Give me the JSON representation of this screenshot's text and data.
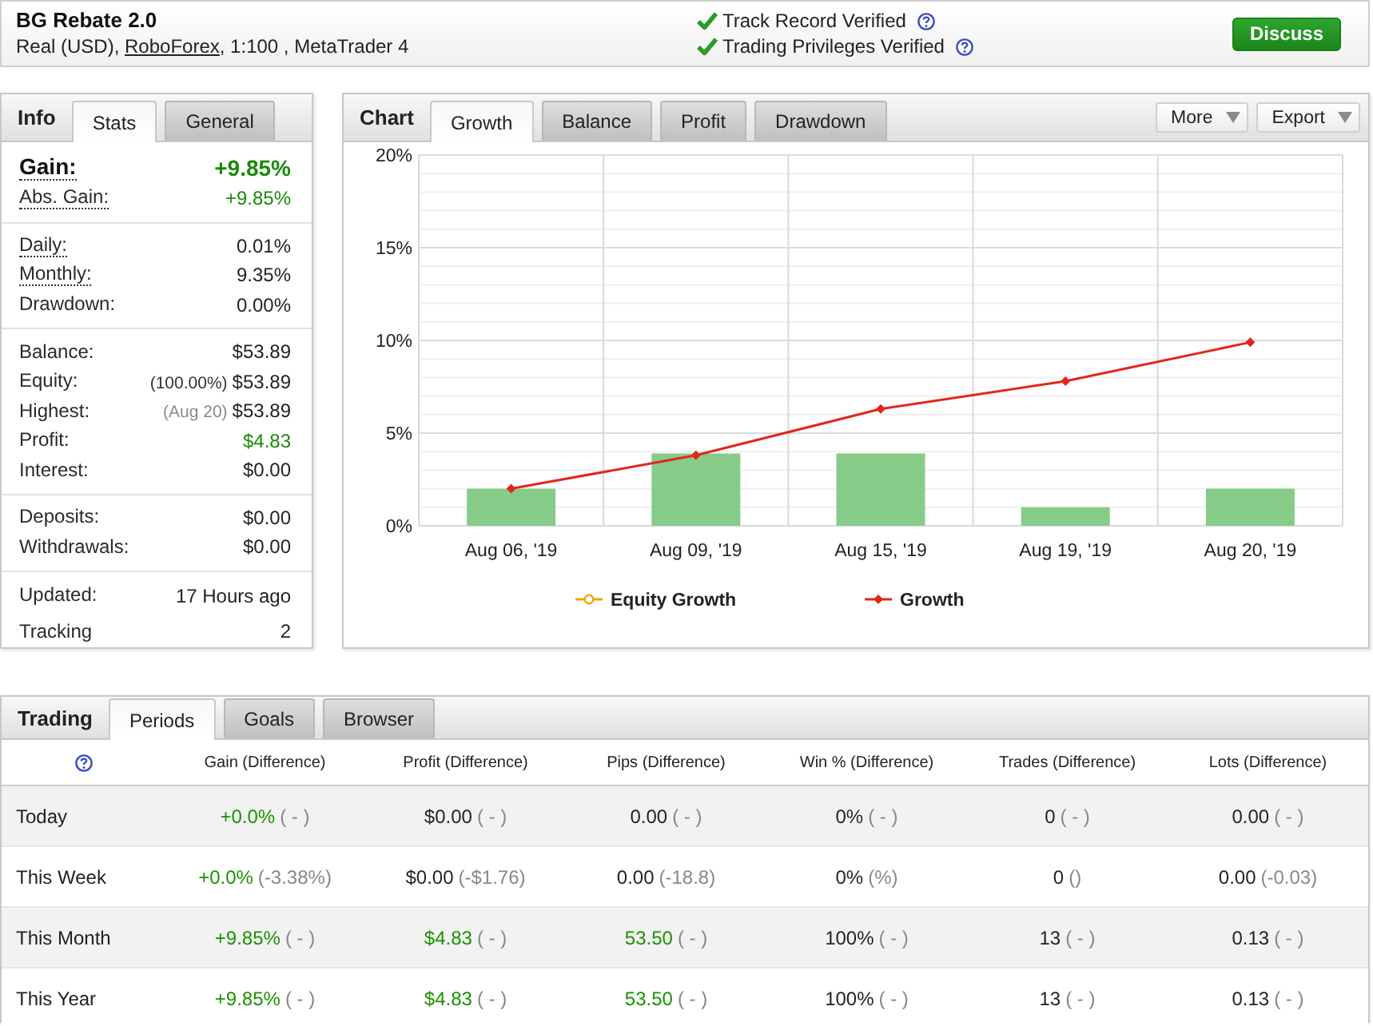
{
  "account": {
    "title": "BG Rebate 2.0",
    "details_before": "Real (USD),",
    "broker": "RoboForex",
    "details_after": ", 1:100 , MetaTrader 4"
  },
  "verifications": [
    {
      "label": "Track Record Verified",
      "verified": true
    },
    {
      "label": "Trading Privileges Verified",
      "verified": true
    }
  ],
  "discuss_button": "Discuss",
  "info_panel": {
    "heading": "Info",
    "tabs": [
      {
        "label": "Stats",
        "selected": true
      },
      {
        "label": "General",
        "selected": false
      }
    ],
    "groups": [
      {
        "rows": [
          {
            "kind": "headline",
            "label": "Gain:",
            "value": "+9.85%",
            "positive": true,
            "tooltip": true
          },
          {
            "kind": "stat",
            "label": "Abs. Gain:",
            "value": "+9.85%",
            "positive": true,
            "tooltip": true
          }
        ]
      },
      {
        "rows": [
          {
            "kind": "stat",
            "label": "Daily:",
            "value": "0.01%",
            "positive": false,
            "tooltip": true
          },
          {
            "kind": "stat",
            "label": "Monthly:",
            "value": "9.35%",
            "positive": false,
            "tooltip": true
          },
          {
            "kind": "stat",
            "label": "Drawdown:",
            "value": "0.00%",
            "positive": false,
            "tooltip": false
          }
        ]
      },
      {
        "rows": [
          {
            "kind": "stat",
            "label": "Balance:",
            "value": "$53.89",
            "positive": false,
            "tooltip": false
          },
          {
            "kind": "stat",
            "label": "Equity:",
            "note": "(100.00%)",
            "note_muted": false,
            "value": "$53.89",
            "positive": false,
            "tooltip": false
          },
          {
            "kind": "stat",
            "label": "Highest:",
            "note": "(Aug 20)",
            "note_muted": true,
            "value": "$53.89",
            "positive": false,
            "tooltip": false
          },
          {
            "kind": "stat",
            "label": "Profit:",
            "value": "$4.83",
            "positive": true,
            "tooltip": false
          },
          {
            "kind": "stat",
            "label": "Interest:",
            "value": "$0.00",
            "positive": false,
            "tooltip": false
          }
        ]
      },
      {
        "rows": [
          {
            "kind": "stat",
            "label": "Deposits:",
            "value": "$0.00",
            "positive": false,
            "tooltip": false
          },
          {
            "kind": "stat",
            "label": "Withdrawals:",
            "value": "$0.00",
            "positive": false,
            "tooltip": false
          }
        ]
      },
      {
        "rows": [
          {
            "kind": "stat",
            "label": "Updated:",
            "value": "17 Hours ago",
            "positive": false,
            "tooltip": false
          },
          {
            "kind": "stat",
            "label": "Tracking",
            "value": "2",
            "positive": false,
            "tooltip": false
          }
        ]
      }
    ]
  },
  "chart_panel": {
    "heading": "Chart",
    "tabs": [
      {
        "label": "Growth",
        "selected": true
      },
      {
        "label": "Balance",
        "selected": false
      },
      {
        "label": "Profit",
        "selected": false
      },
      {
        "label": "Drawdown",
        "selected": false
      }
    ],
    "menus": [
      "More",
      "Export"
    ],
    "chart_data": {
      "type": "bar",
      "grid": true,
      "categories": [
        "Aug 06, '19",
        "Aug 09, '19",
        "Aug 15, '19",
        "Aug 19, '19",
        "Aug 20, '19"
      ],
      "series": [
        {
          "color": "#86cc88",
          "values": [
            2.0,
            3.9,
            3.9,
            1.0,
            2.0
          ]
        },
        {
          "type": "line",
          "name": "Equity Growth",
          "color": "#f0a30a",
          "marker": "circle",
          "values": [
            null,
            null,
            null,
            null,
            null
          ]
        },
        {
          "type": "line",
          "name": "Growth",
          "color": "#e3261b",
          "marker": "diamond",
          "values": [
            2.0,
            3.8,
            6.3,
            7.8,
            9.9
          ]
        }
      ],
      "ylim": [
        0,
        20
      ],
      "yticks": [
        {
          "value": 0,
          "label": "0%"
        },
        {
          "value": 5,
          "label": "5%"
        },
        {
          "value": 10,
          "label": "10%"
        },
        {
          "value": 15,
          "label": "15%"
        },
        {
          "value": 20,
          "label": "20%"
        }
      ]
    }
  },
  "trading_panel": {
    "heading": "Trading",
    "tabs": [
      {
        "label": "Periods",
        "selected": true
      },
      {
        "label": "Goals",
        "selected": false
      },
      {
        "label": "Browser",
        "selected": false
      }
    ],
    "columns": [
      "Gain (Difference)",
      "Profit (Difference)",
      "Pips (Difference)",
      "Win % (Difference)",
      "Trades (Difference)",
      "Lots (Difference)"
    ],
    "rows": [
      {
        "period": "Today",
        "cells": [
          {
            "value": "+0.0%",
            "difference": "( - )",
            "positive": true
          },
          {
            "value": "$0.00",
            "difference": "( - )",
            "positive": false
          },
          {
            "value": "0.00",
            "difference": "( - )",
            "positive": false
          },
          {
            "value": "0%",
            "difference": "( - )",
            "positive": false
          },
          {
            "value": "0",
            "difference": "( - )",
            "positive": false
          },
          {
            "value": "0.00",
            "difference": "( - )",
            "positive": false
          }
        ]
      },
      {
        "period": "This Week",
        "cells": [
          {
            "value": "+0.0%",
            "difference": "(-3.38%)",
            "positive": true
          },
          {
            "value": "$0.00",
            "difference": "(-$1.76)",
            "positive": false
          },
          {
            "value": "0.00",
            "difference": "(-18.8)",
            "positive": false
          },
          {
            "value": "0%",
            "difference": "(%)",
            "positive": false
          },
          {
            "value": "0",
            "difference": "()",
            "positive": false
          },
          {
            "value": "0.00",
            "difference": "(-0.03)",
            "positive": false
          }
        ]
      },
      {
        "period": "This Month",
        "cells": [
          {
            "value": "+9.85%",
            "difference": "( - )",
            "positive": true
          },
          {
            "value": "$4.83",
            "difference": "( - )",
            "positive": true
          },
          {
            "value": "53.50",
            "difference": "( - )",
            "positive": true
          },
          {
            "value": "100%",
            "difference": "( - )",
            "positive": false
          },
          {
            "value": "13",
            "difference": "( - )",
            "positive": false
          },
          {
            "value": "0.13",
            "difference": "( - )",
            "positive": false
          }
        ]
      },
      {
        "period": "This Year",
        "cells": [
          {
            "value": "+9.85%",
            "difference": "( - )",
            "positive": true
          },
          {
            "value": "$4.83",
            "difference": "( - )",
            "positive": true
          },
          {
            "value": "53.50",
            "difference": "( - )",
            "positive": true
          },
          {
            "value": "100%",
            "difference": "( - )",
            "positive": false
          },
          {
            "value": "13",
            "difference": "( - )",
            "positive": false
          },
          {
            "value": "0.13",
            "difference": "( - )",
            "positive": false
          }
        ]
      }
    ]
  }
}
